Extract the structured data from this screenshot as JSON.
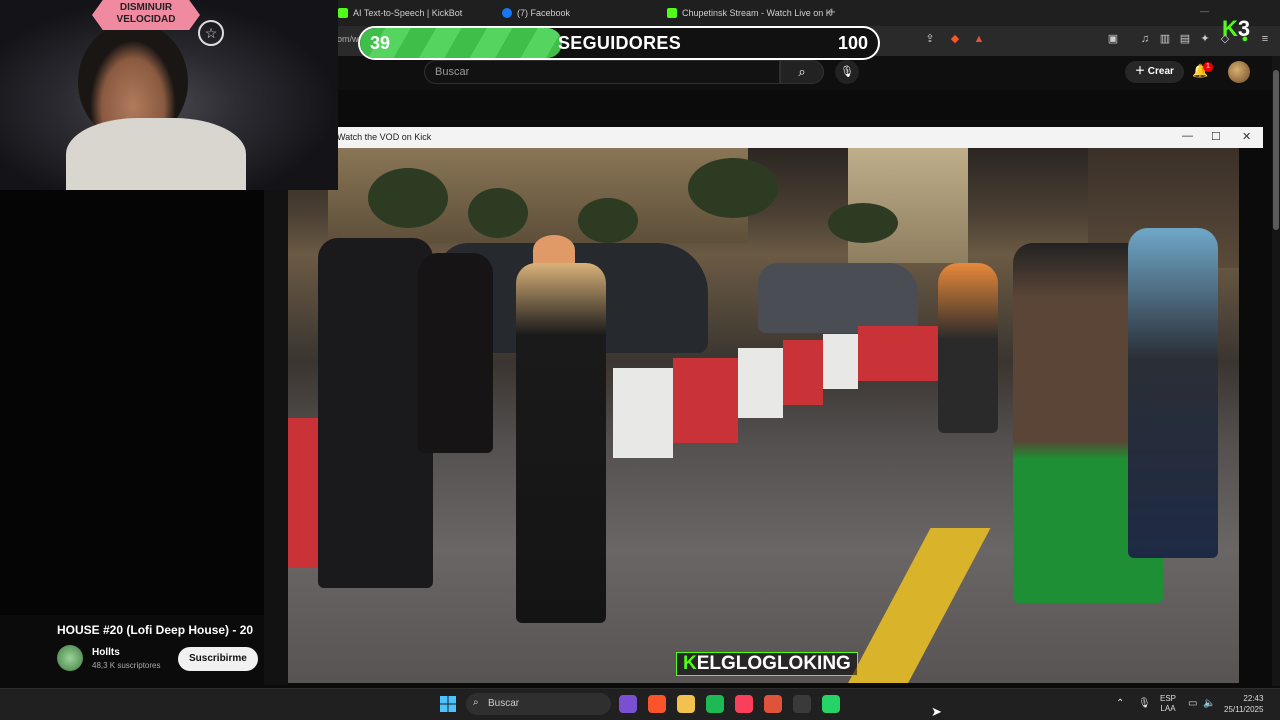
{
  "browser": {
    "tabs": [
      {
        "label": "AI Text-to-Speech | KickBot",
        "favicon_color": "#53fc18"
      },
      {
        "label": "(7) Facebook",
        "favicon_color": "#1877f2"
      },
      {
        "label": "Chupetinsk Stream - Watch Live on K",
        "favicon_color": "#53fc18"
      }
    ],
    "new_tab": "+",
    "address_fragment": "om/w",
    "toolbar_icons": [
      "share-icon",
      "brave-shield-icon",
      "rewards-icon",
      "media-icon",
      "music-icon",
      "sidebar-icon",
      "wallet-icon",
      "extensions-icon",
      "vpn-icon",
      "profile-icon",
      "menu-icon"
    ]
  },
  "followers_goal": {
    "current": "39",
    "label": "SEGUIDORES",
    "goal": "100",
    "progress": 0.39,
    "fill_color": "#3fbf4a"
  },
  "kick_badge": {
    "logo": "K",
    "count": "3"
  },
  "webcam": {
    "sign_text": "DISMINUIR VELOCIDAD"
  },
  "youtube": {
    "search_placeholder": "Buscar",
    "create_label": "Crear",
    "notifications": "1"
  },
  "popup": {
    "title": "Watch the VOD on Kick",
    "controls": [
      "minimize",
      "maximize",
      "close"
    ]
  },
  "video": {
    "caption_prefix": "K",
    "caption": "ELGLOGLOKING"
  },
  "sidebar_video": {
    "title": "HOUSE #20 (Lofi Deep House) - 20",
    "channel": "Hollts",
    "subscribers": "48,3 K suscriptores",
    "subscribe_label": "Suscribirme"
  },
  "taskbar": {
    "search_label": "Buscar",
    "lang_top": "ESP",
    "lang_bottom": "LAA",
    "time": "22:43",
    "date": "25/11/2025",
    "apps": [
      {
        "name": "affinity-app-icon",
        "color": "#7b4fd1"
      },
      {
        "name": "brave-app-icon",
        "color": "#fb542b"
      },
      {
        "name": "files-app-icon",
        "color": "#f2c14e"
      },
      {
        "name": "spotify-app-icon",
        "color": "#1db954"
      },
      {
        "name": "itunes-app-icon",
        "color": "#fa3f5a"
      },
      {
        "name": "brave-beta-app-icon",
        "color": "#e0533b"
      },
      {
        "name": "obs-app-icon",
        "color": "#3a3a3a"
      },
      {
        "name": "whatsapp-app-icon",
        "color": "#25d366"
      }
    ]
  }
}
